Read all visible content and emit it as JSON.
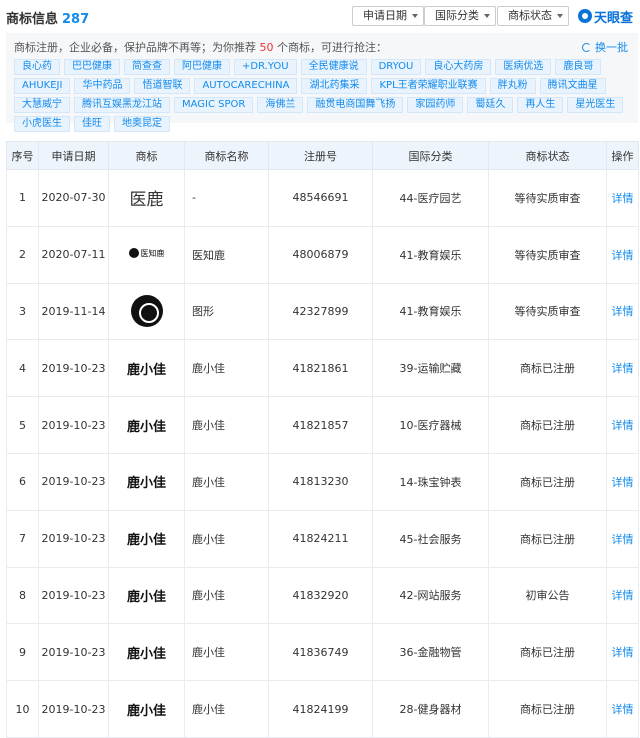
{
  "header": {
    "title": "商标信息",
    "count": "287",
    "filters": [
      {
        "label": "申请日期"
      },
      {
        "label": "国际分类"
      },
      {
        "label": "商标状态"
      }
    ],
    "logo_text": "天眼查"
  },
  "promo": {
    "text_prefix": "商标注册，企业必备，保护品牌不再等；为你推荐",
    "number": "50",
    "text_suffix": "个商标，可进行抢注：",
    "refresh_label": "换一批",
    "tags": [
      "良心药",
      "巴巴健康",
      "简查查",
      "阿巴健康",
      "+DR.YOU",
      "全民健康说",
      "DRYOU",
      "良心大药房",
      "医病优选",
      "鹿良哥",
      "AHUKEJI",
      "华中药品",
      "悟道智联",
      "AUTOCARECHINA",
      "湖北药集采",
      "KPL王者荣耀职业联赛",
      "胖丸粉",
      "腾讯文曲星",
      "大慧威宁",
      "腾讯互娱黑龙江站",
      "MAGIC SPOR",
      "海佛兰",
      "融贯电商国舞飞扬",
      "家园药师",
      "蜀廷久",
      "再人生",
      "星光医生",
      "小虎医生",
      "佳旺",
      "地奥昆定"
    ]
  },
  "table": {
    "headers": [
      "序号",
      "申请日期",
      "商标",
      "商标名称",
      "注册号",
      "国际分类",
      "商标状态",
      "操作"
    ],
    "rows": [
      {
        "no": "1",
        "date": "2020-07-30",
        "mark": "医鹿",
        "mark_type": "serif",
        "name": "-",
        "reg": "48546691",
        "cls": "44-医疗园艺",
        "status": "等待实质审查",
        "op": "详情"
      },
      {
        "no": "2",
        "date": "2020-07-11",
        "mark": "医知鹿",
        "mark_type": "small",
        "name": "医知鹿",
        "reg": "48006879",
        "cls": "41-教育娱乐",
        "status": "等待实质审查",
        "op": "详情"
      },
      {
        "no": "3",
        "date": "2019-11-14",
        "mark": "",
        "mark_type": "round",
        "name": "图形",
        "reg": "42327899",
        "cls": "41-教育娱乐",
        "status": "等待实质审查",
        "op": "详情"
      },
      {
        "no": "4",
        "date": "2019-10-23",
        "mark": "鹿小佳",
        "mark_type": "bold",
        "name": "鹿小佳",
        "reg": "41821861",
        "cls": "39-运输贮藏",
        "status": "商标已注册",
        "op": "详情"
      },
      {
        "no": "5",
        "date": "2019-10-23",
        "mark": "鹿小佳",
        "mark_type": "bold",
        "name": "鹿小佳",
        "reg": "41821857",
        "cls": "10-医疗器械",
        "status": "商标已注册",
        "op": "详情"
      },
      {
        "no": "6",
        "date": "2019-10-23",
        "mark": "鹿小佳",
        "mark_type": "bold",
        "name": "鹿小佳",
        "reg": "41813230",
        "cls": "14-珠宝钟表",
        "status": "商标已注册",
        "op": "详情"
      },
      {
        "no": "7",
        "date": "2019-10-23",
        "mark": "鹿小佳",
        "mark_type": "bold",
        "name": "鹿小佳",
        "reg": "41824211",
        "cls": "45-社会服务",
        "status": "商标已注册",
        "op": "详情"
      },
      {
        "no": "8",
        "date": "2019-10-23",
        "mark": "鹿小佳",
        "mark_type": "bold",
        "name": "鹿小佳",
        "reg": "41832920",
        "cls": "42-网站服务",
        "status": "初审公告",
        "op": "详情"
      },
      {
        "no": "9",
        "date": "2019-10-23",
        "mark": "鹿小佳",
        "mark_type": "bold",
        "name": "鹿小佳",
        "reg": "41836749",
        "cls": "36-金融物管",
        "status": "商标已注册",
        "op": "详情"
      },
      {
        "no": "10",
        "date": "2019-10-23",
        "mark": "鹿小佳",
        "mark_type": "bold",
        "name": "鹿小佳",
        "reg": "41824199",
        "cls": "28-健身器材",
        "status": "商标已注册",
        "op": "详情"
      }
    ]
  }
}
